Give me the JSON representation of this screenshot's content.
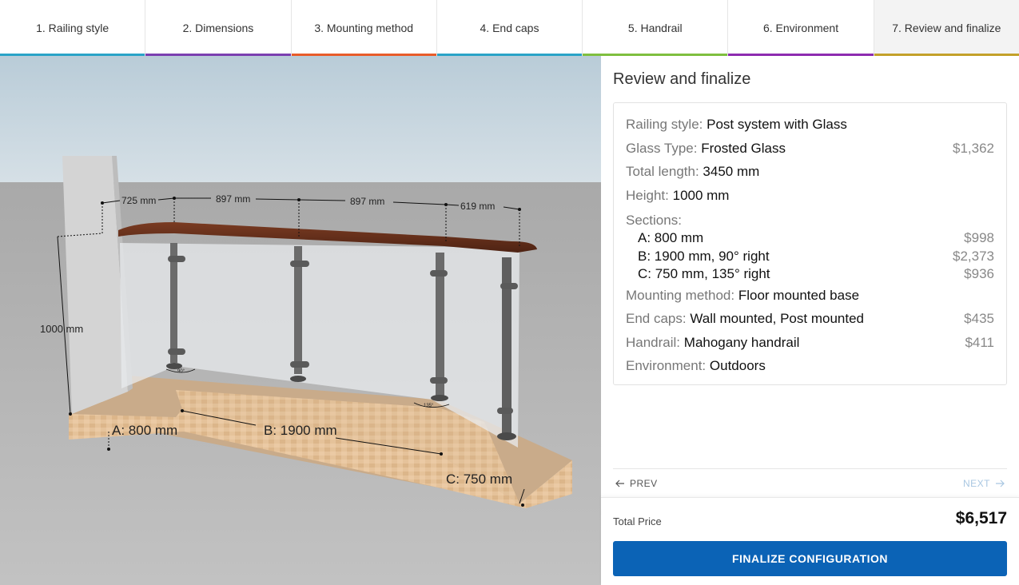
{
  "tabs": [
    {
      "label": "1. Railing style",
      "color": "#2aa3c7"
    },
    {
      "label": "2. Dimensions",
      "color": "#7b3fb0"
    },
    {
      "label": "3. Mounting method",
      "color": "#e85c2a"
    },
    {
      "label": "4. End caps",
      "color": "#2aa3c7"
    },
    {
      "label": "5. Handrail",
      "color": "#7fbf3f"
    },
    {
      "label": "6. Environment",
      "color": "#8e2bb0"
    },
    {
      "label": "7. Review and finalize",
      "color": "#c3a12a"
    }
  ],
  "viewer": {
    "top_dims": [
      "725 mm",
      "897 mm",
      "897 mm",
      "619 mm"
    ],
    "height_dim": "1000 mm",
    "section_a": "A: 800 mm",
    "section_b": "B: 1900 mm",
    "section_c": "C: 750 mm",
    "angle_1": "90°",
    "angle_2": "135°"
  },
  "panel": {
    "title": "Review and finalize",
    "railing_style": {
      "label": "Railing style:",
      "value": "Post system with Glass"
    },
    "glass_type": {
      "label": "Glass Type:",
      "value": "Frosted Glass",
      "price": "$1,362"
    },
    "total_length": {
      "label": "Total length:",
      "value": "3450 mm"
    },
    "height": {
      "label": "Height:",
      "value": "1000 mm"
    },
    "sections_label": "Sections:",
    "sections": [
      {
        "label": "A: 800 mm",
        "price": "$998"
      },
      {
        "label": "B: 1900 mm, 90° right",
        "price": "$2,373"
      },
      {
        "label": "C: 750 mm, 135° right",
        "price": "$936"
      }
    ],
    "mounting": {
      "label": "Mounting method:",
      "value": "Floor mounted base"
    },
    "end_caps": {
      "label": "End caps:",
      "value": "Wall mounted, Post mounted",
      "price": "$435"
    },
    "handrail": {
      "label": "Handrail:",
      "value": "Mahogany handrail",
      "price": "$411"
    },
    "environment": {
      "label": "Environment:",
      "value": "Outdoors"
    },
    "prev_label": "PREV",
    "next_label": "NEXT",
    "total_label": "Total Price",
    "total_value": "$6,517",
    "finalize_label": "FINALIZE CONFIGURATION"
  },
  "icons": {
    "prev": "arrow-left-icon",
    "next": "arrow-right-icon"
  },
  "colors": {
    "accent": "#0b63b6",
    "next_disabled": "#a9c7e2"
  }
}
